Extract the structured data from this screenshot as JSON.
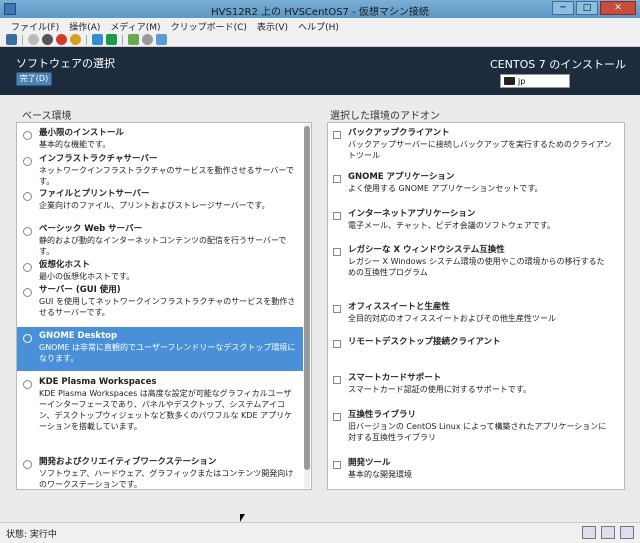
{
  "window": {
    "title": "HVS12R2 上の HVSCentOS7  - 仮想マシン接続",
    "minimize": "─",
    "maximize": "□",
    "close": "✕"
  },
  "menu": [
    "ファイル(F)",
    "操作(A)",
    "メディア(M)",
    "クリップボード(C)",
    "表示(V)",
    "ヘルプ(H)"
  ],
  "toolbar_icons": [
    "ctrl-alt-del-icon",
    "start-icon",
    "turn-off-icon",
    "shutdown-icon",
    "save-icon",
    "pause-icon",
    "reset-icon",
    "checkpoint-icon",
    "revert-icon",
    "enhanced-session-icon"
  ],
  "header": {
    "page_title": "ソフトウェアの選択",
    "done_button": "完了(D)",
    "install_title": "CENTOS 7 のインストール",
    "keyboard_layout": "jp"
  },
  "base_env": {
    "heading": "ベース環境",
    "items": [
      {
        "name": "最小限のインストール",
        "desc": "基本的な機能です。"
      },
      {
        "name": "インフラストラクチャサーバー",
        "desc": "ネットワークインフラストラクチャのサービスを動作させるサーバーです。"
      },
      {
        "name": "ファイルとプリントサーバー",
        "desc": "企業向けのファイル、プリントおよびストレージサーバーです。"
      },
      {
        "name": "ベーシック Web サーバー",
        "desc": "静的および動的なインターネットコンテンツの配信を行うサーバーです。"
      },
      {
        "name": "仮想化ホスト",
        "desc": "最小の仮想化ホストです。"
      },
      {
        "name": "サーバー (GUI 使用)",
        "desc": "GUI を使用してネットワークインフラストラクチャのサービスを動作させるサーバーです。"
      },
      {
        "name": "GNOME Desktop",
        "desc": "GNOME は非常に直観的でユーザーフレンドリーなデスクトップ環境になります。",
        "selected": true
      },
      {
        "name": "KDE Plasma Workspaces",
        "desc": "KDE Plasma Workspaces は高度な設定が可能なグラフィカルユーザーインターフェースであり、パネルやデスクトップ、システムアイコン、デスクトップウィジェットなど数多くのパワフルな KDE アプリケーションを搭載しています。"
      },
      {
        "name": "開発およびクリエイティブワークステーション",
        "desc": "ソフトウェア、ハードウェア、グラフィックまたはコンテンツ開発向けのワークステーションです。"
      }
    ]
  },
  "addons": {
    "heading": "選択した環境のアドオン",
    "items": [
      {
        "name": "バックアップクライアント",
        "desc": "バックアップサーバーに接続しバックアップを実行するためのクライアントツール"
      },
      {
        "name": "GNOME アプリケーション",
        "desc": "よく使用する GNOME アプリケーションセットです。"
      },
      {
        "name": "インターネットアプリケーション",
        "desc": "電子メール、チャット、ビデオ会議のソフトウェアです。"
      },
      {
        "name": "レガシーな X ウィンドウシステム互換性",
        "desc": "レガシー X Windows システム環境の使用やこの環境からの移行するための互換性プログラム"
      },
      {
        "name": "オフィススイートと生産性",
        "desc": "全目的対応のオフィススイートおよびその他生産性ツール"
      },
      {
        "name": "リモートデスクトップ接続クライアント",
        "desc": ""
      },
      {
        "name": "スマートカードサポート",
        "desc": "スマートカード認証の使用に対するサポートです。"
      },
      {
        "name": "互換性ライブラリ",
        "desc": "旧バージョンの CentOS Linux によって構築されたアプリケーションに対する互換性ライブラリ"
      },
      {
        "name": "開発ツール",
        "desc": "基本的な開発環境"
      }
    ]
  },
  "statusbar": {
    "status": "状態: 実行中"
  }
}
